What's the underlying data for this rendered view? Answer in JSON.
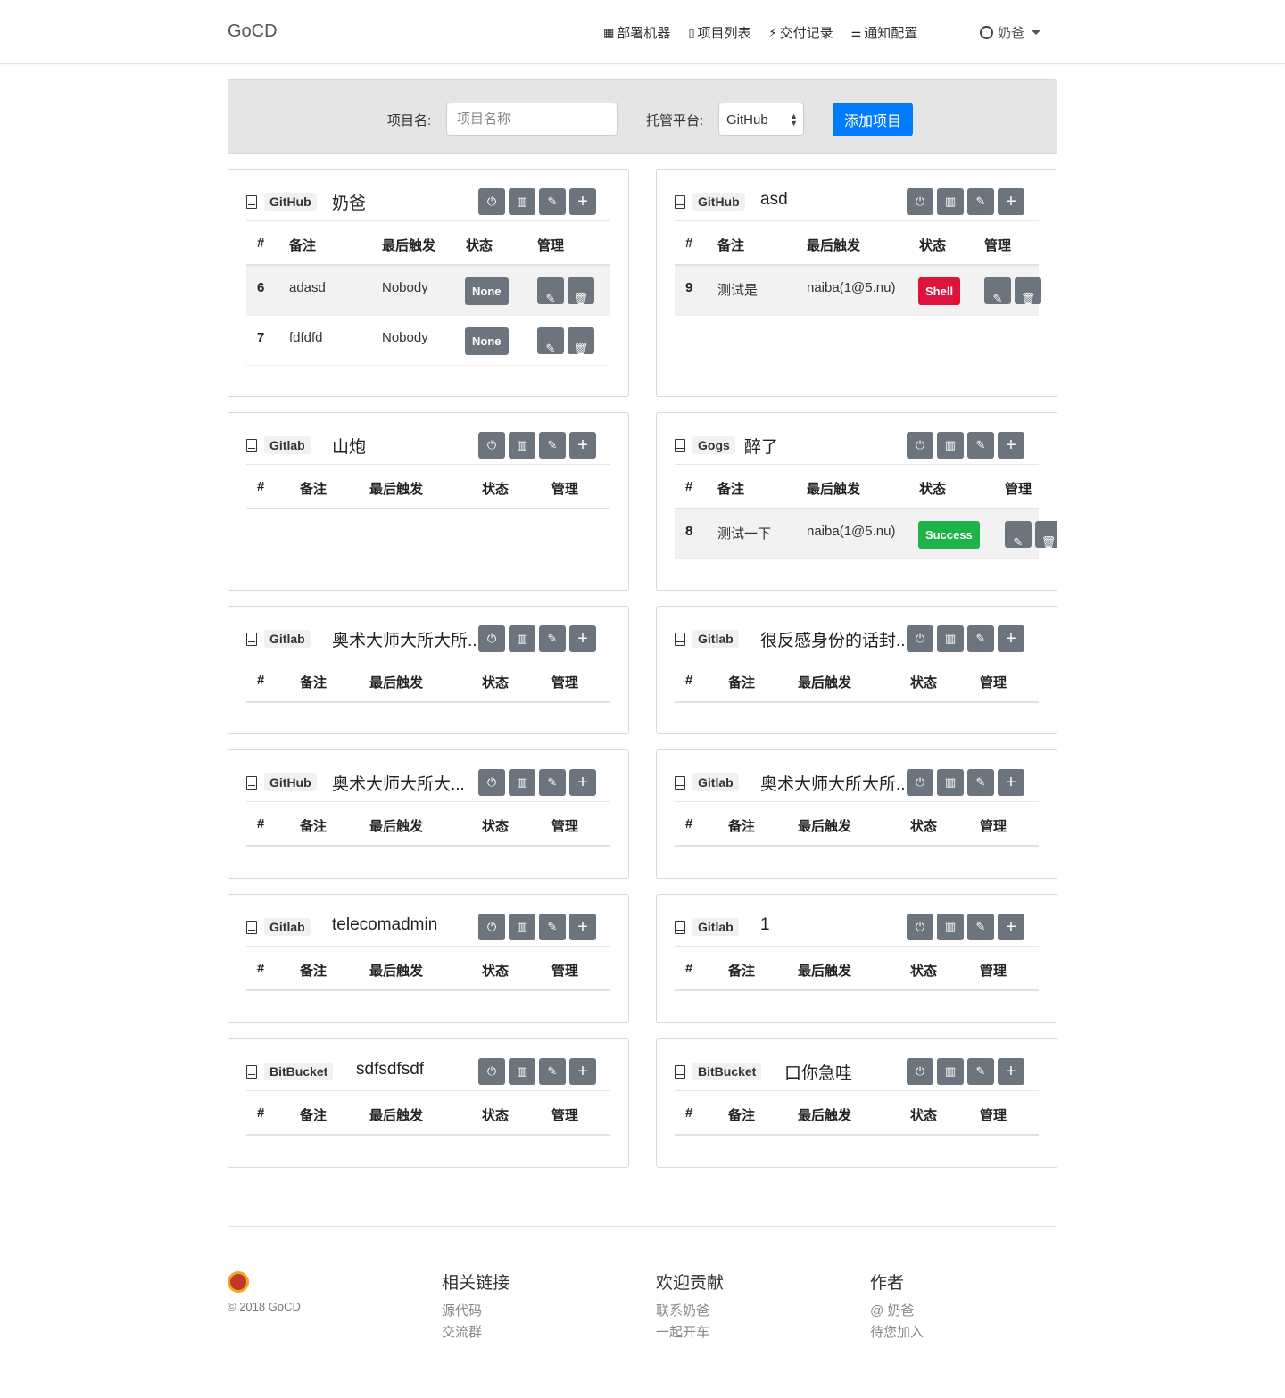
{
  "brand": "GoCD",
  "nav": {
    "items": [
      {
        "icon": "server-icon",
        "glyph": "▦",
        "label": "部署机器"
      },
      {
        "icon": "book-icon",
        "glyph": "▯",
        "label": "项目列表"
      },
      {
        "icon": "bolt-icon",
        "glyph": "⚡",
        "label": "交付记录"
      },
      {
        "icon": "sliders-icon",
        "glyph": "⚌",
        "label": "通知配置"
      }
    ],
    "user": "奶爸"
  },
  "add_form": {
    "name_label": "项目名:",
    "name_placeholder": "项目名称",
    "platform_label": "托管平台:",
    "platform_value": "GitHub",
    "submit_label": "添加项目"
  },
  "table_headers": {
    "id": "#",
    "note": "备注",
    "last": "最后触发",
    "status": "状态",
    "manage": "管理"
  },
  "projects": [
    {
      "platform": "GitHub",
      "name": "奶爸",
      "rows": [
        {
          "id": "6",
          "note": "adasd",
          "last": "Nobody",
          "status": "None"
        },
        {
          "id": "7",
          "note": "fdfdfd",
          "last": "Nobody",
          "status": "None"
        }
      ]
    },
    {
      "platform": "GitHub",
      "name": "asd",
      "rows": [
        {
          "id": "9",
          "note": "测试是",
          "last": "naiba(1@5.nu)",
          "status": "Shell"
        }
      ]
    },
    {
      "platform": "Gitlab",
      "name": "山炮",
      "rows": []
    },
    {
      "platform": "Gogs",
      "name": "醉了",
      "rows": [
        {
          "id": "8",
          "note": "测试一下",
          "last": "naiba(1@5.nu)",
          "status": "Success"
        }
      ]
    },
    {
      "platform": "Gitlab",
      "name": "奥术大师大所大所...",
      "rows": []
    },
    {
      "platform": "Gitlab",
      "name": "很反感身份的话封...",
      "rows": []
    },
    {
      "platform": "GitHub",
      "name": "奥术大师大所大...",
      "rows": []
    },
    {
      "platform": "Gitlab",
      "name": "奥术大师大所大所...",
      "rows": []
    },
    {
      "platform": "Gitlab",
      "name": "telecomadmin",
      "rows": []
    },
    {
      "platform": "Gitlab",
      "name": "1",
      "rows": []
    },
    {
      "platform": "BitBucket",
      "name": "sdfsdfsdf",
      "rows": []
    },
    {
      "platform": "BitBucket",
      "name": "口你急哇",
      "rows": []
    }
  ],
  "footer": {
    "copyright": "© 2018 GoCD",
    "columns": [
      {
        "title": "相关链接",
        "links": [
          "源代码",
          "交流群"
        ]
      },
      {
        "title": "欢迎贡献",
        "links": [
          "联系奶爸",
          "一起开车"
        ]
      },
      {
        "title": "作者",
        "links": [
          "@ 奶爸",
          "待您加入"
        ]
      }
    ]
  },
  "colors": {
    "primary": "#007bff",
    "secondary": "#6c757d",
    "danger": "#dc143c",
    "success": "#1db348"
  }
}
